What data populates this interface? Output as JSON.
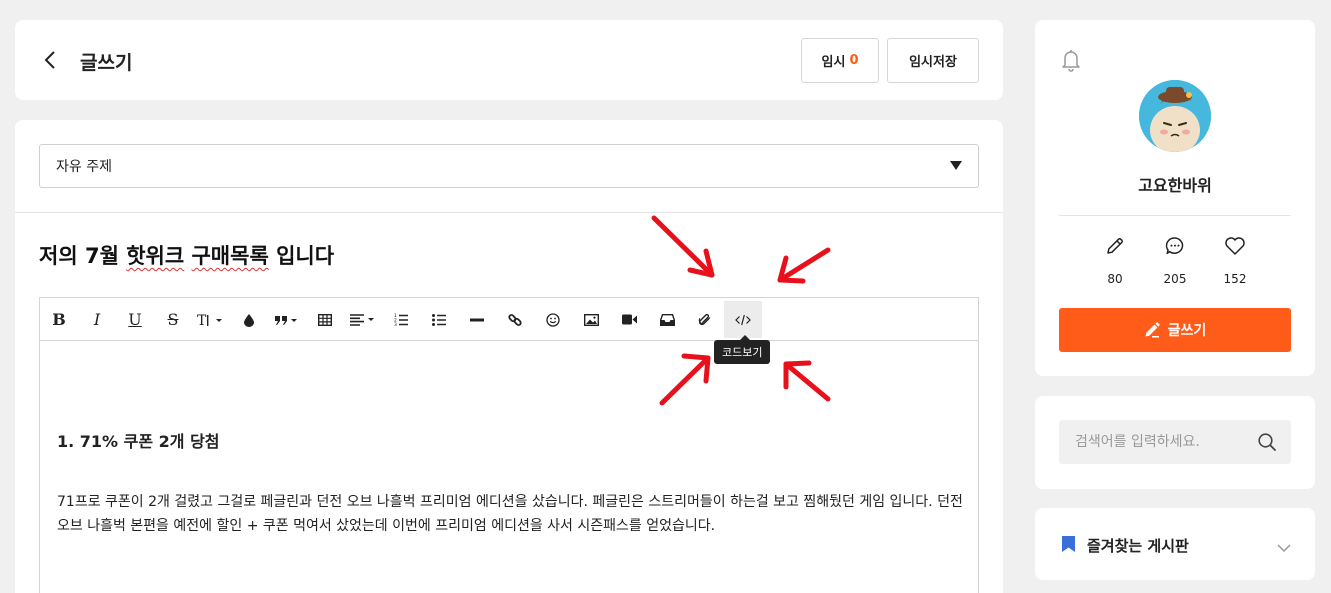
{
  "header": {
    "title": "글쓰기",
    "temp_label": "임시",
    "temp_count": "0",
    "temp_save_label": "임시저장"
  },
  "editor": {
    "category": "자유 주제",
    "post_title_parts": [
      "저의 7월 ",
      "핫위크",
      " ",
      "구매목록",
      " 입니다"
    ],
    "toolbar_tooltip": "코드보기",
    "toolbar": [
      "bold-icon",
      "italic-icon",
      "underline-icon",
      "strikethrough-icon",
      "font-size-icon",
      "text-color-icon",
      "quote-icon",
      "table-icon",
      "align-icon",
      "ordered-list-icon",
      "bullet-list-icon",
      "horizontal-rule-icon",
      "link-icon",
      "emoji-icon",
      "image-icon",
      "video-icon",
      "embed-icon",
      "attachment-icon",
      "code-view-icon"
    ],
    "heading": "1. 71% 쿠폰 2개 당첨",
    "paragraph": "71프로 쿠폰이 2개 걸렸고 그걸로 페글린과 던전 오브 나흘벅 프리미엄 에디션을 샀습니다. 페글린은 스트리머들이 하는걸 보고 찜해뒀던 게임 입니다. 던전 오브 나흘벅 본편을 예전에 할인 + 쿠폰 먹여서 샀었는데 이번에 프리미엄 에디션을 사서 시즌패스를 얻었습니다."
  },
  "profile": {
    "nickname": "고요한바위",
    "stats": [
      {
        "icon": "pencil-icon",
        "value": "80"
      },
      {
        "icon": "comment-icon",
        "value": "205"
      },
      {
        "icon": "heart-icon",
        "value": "152"
      }
    ],
    "write_label": "글쓰기"
  },
  "search": {
    "placeholder": "검색어를 입력하세요."
  },
  "favorites": {
    "title": "즐겨찾는 게시판"
  },
  "colors": {
    "accent": "#ff5c1a",
    "annotation_arrow": "#e8111b",
    "bookmark": "#3a6ed8"
  }
}
